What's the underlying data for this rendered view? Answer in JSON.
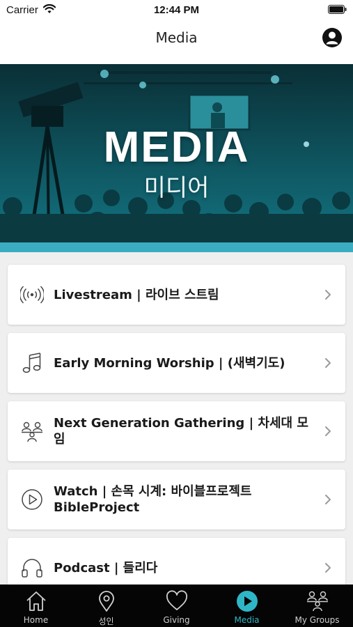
{
  "status_bar": {
    "carrier": "Carrier",
    "time": "12:44 PM"
  },
  "nav": {
    "title": "Media",
    "profile_icon": "person-circle-icon"
  },
  "hero": {
    "title": "MEDIA",
    "subtitle": "미디어"
  },
  "menu": {
    "items": [
      {
        "label": "Livestream | 라이브 스트림",
        "icon": "broadcast-icon"
      },
      {
        "label": "Early Morning Worship | (새벽기도)",
        "icon": "music-note-icon"
      },
      {
        "label": "Next Generation Gathering | 차세대 모임",
        "icon": "group-icon"
      },
      {
        "label": "Watch | 손목 시계: 바이블프로젝트 BibleProject",
        "icon": "play-circle-icon"
      },
      {
        "label": "Podcast | 들리다",
        "icon": "headphones-icon"
      }
    ]
  },
  "tabs": [
    {
      "label": "Home",
      "icon": "home-icon"
    },
    {
      "label": "성인",
      "icon": "map-pin-icon"
    },
    {
      "label": "Giving",
      "icon": "heart-icon"
    },
    {
      "label": "Media",
      "icon": "play-circle-icon",
      "active": true
    },
    {
      "label": "My Groups",
      "icon": "group-icon"
    }
  ],
  "colors": {
    "accent": "#2fb6c6",
    "tab_bar": "#050505",
    "hero_teal": "#14707c"
  }
}
